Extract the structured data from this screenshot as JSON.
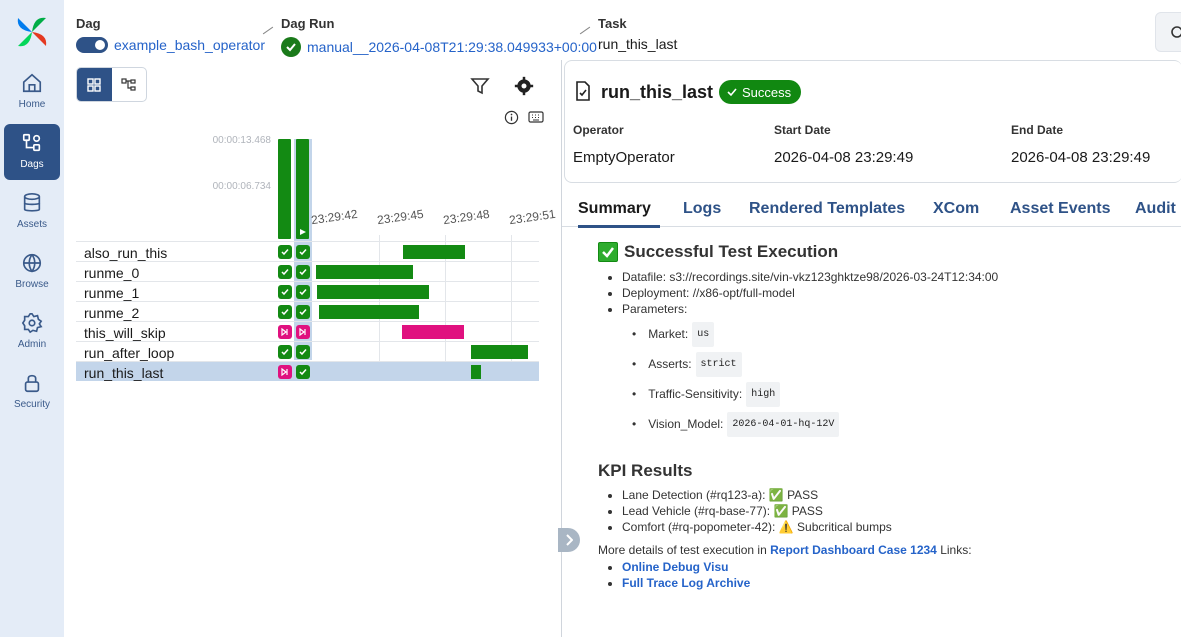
{
  "nav": {
    "items": [
      {
        "label": "Home",
        "icon": "home-icon"
      },
      {
        "label": "Dags",
        "icon": "dags-icon"
      },
      {
        "label": "Assets",
        "icon": "database-icon"
      },
      {
        "label": "Browse",
        "icon": "globe-icon"
      },
      {
        "label": "Admin",
        "icon": "gear-icon"
      },
      {
        "label": "Security",
        "icon": "lock-icon"
      }
    ],
    "active": "Dags"
  },
  "header": {
    "dag_label": "Dag",
    "dag_value": "example_bash_operator",
    "dag_run_label": "Dag Run",
    "dag_run_value": "manual__2026-04-08T21:29:38.049933+00:00",
    "task_label": "Task",
    "task_value": "run_this_last"
  },
  "grid": {
    "durations": [
      "00:00:13.468",
      "00:00:06.734"
    ],
    "times": [
      "23:29:42",
      "23:29:45",
      "23:29:48",
      "23:29:51"
    ],
    "tasks": [
      {
        "name": "also_run_this",
        "state": "success"
      },
      {
        "name": "runme_0",
        "state": "success"
      },
      {
        "name": "runme_1",
        "state": "success"
      },
      {
        "name": "runme_2",
        "state": "success"
      },
      {
        "name": "this_will_skip",
        "state": "skipped"
      },
      {
        "name": "run_after_loop",
        "state": "success"
      },
      {
        "name": "run_this_last",
        "state": "success",
        "selected": true
      }
    ],
    "colors": {
      "success": "#138a13",
      "skipped": "#e0117f",
      "accent": "#2e5287"
    }
  },
  "detail": {
    "task_title": "run_this_last",
    "status": "Success",
    "operator_label": "Operator",
    "operator_value": "EmptyOperator",
    "start_label": "Start Date",
    "start_value": "2026-04-08 23:29:49",
    "end_label": "End Date",
    "end_value": "2026-04-08 23:29:49",
    "tabs": [
      "Summary",
      "Logs",
      "Rendered Templates",
      "XCom",
      "Asset Events",
      "Audit"
    ],
    "active_tab": "Summary"
  },
  "summary": {
    "heading": "Successful Test Execution",
    "datafile": "Datafile: s3://recordings.site/vin-vkz123ghktze98/2026-03-24T12:34:00",
    "deployment": "Deployment: //x86-opt/full-model",
    "parameters": "Parameters:",
    "params": [
      {
        "key": "Market:",
        "value": "us"
      },
      {
        "key": "Asserts:",
        "value": "strict"
      },
      {
        "key": "Traffic-Sensitivity:",
        "value": "high"
      },
      {
        "key": "Vision_Model:",
        "value": "2026-04-01-hq-12V"
      }
    ],
    "kpi_heading": "KPI Results",
    "kpis": [
      {
        "label": "Lane Detection (#rq123-a):",
        "mark": "✅",
        "result": "PASS"
      },
      {
        "label": "Lead Vehicle (#rq-base-77):",
        "mark": "✅",
        "result": "PASS"
      },
      {
        "label": "Comfort (#rq-popometer-42):",
        "mark": "⚠️",
        "result": "Subcritical bumps"
      }
    ],
    "more_text": "More details of test execution in",
    "report_link": "Report Dashboard Case 1234",
    "links_text": "Links:",
    "links": [
      "Online Debug Visu",
      "Full Trace Log Archive"
    ]
  }
}
